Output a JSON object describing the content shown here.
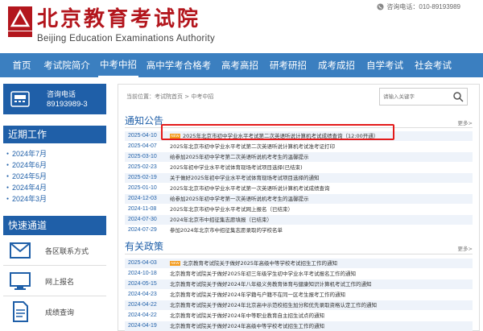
{
  "header": {
    "logo_cn": "北京教育考试院",
    "logo_en": "Beijing Education Examinations Authority",
    "hotline": "咨询电话：010-89193989"
  },
  "nav": {
    "items": [
      {
        "label": "首页"
      },
      {
        "label": "考试院简介"
      },
      {
        "label": "中考中招"
      },
      {
        "label": "高中学考合格考"
      },
      {
        "label": "高考高招"
      },
      {
        "label": "研考研招"
      },
      {
        "label": "成考成招"
      },
      {
        "label": "自学考试"
      },
      {
        "label": "社会考试"
      }
    ]
  },
  "sidebar": {
    "hotline_title": "咨询电话",
    "hotline_number": "89193989-3",
    "recent_title": "近期工作",
    "months": [
      "2024年7月",
      "2024年6月",
      "2024年5月",
      "2024年4月",
      "2024年3月"
    ],
    "quick_title": "快速通道",
    "quick_items": [
      {
        "label": "各区联系方式",
        "icon": "contact-icon"
      },
      {
        "label": "网上报名",
        "icon": "monitor-icon"
      },
      {
        "label": "成绩查询",
        "icon": "document-icon"
      }
    ]
  },
  "main": {
    "breadcrumb": "当前位置：考试院首页 > 中考中招",
    "search_placeholder": "请输入关键字",
    "notice": {
      "title": "通知公告",
      "more": "更多>",
      "rows": [
        {
          "date": "2025-04-10",
          "badge": "NEW",
          "title": "2025年北京市初中学业水平考试第二次英语听说计算机考试成绩查询（12:00开通）"
        },
        {
          "date": "2025-04-07",
          "badge": "",
          "title": "2025年北京市初中学业水平考试第二次英语听说计算机考试准考证打印"
        },
        {
          "date": "2025-03-10",
          "badge": "",
          "title": "给参加2025年初中学考第二次英语听说机考考生的温馨提示"
        },
        {
          "date": "2025-02-23",
          "badge": "",
          "title": "2025年初中学业水平考试体育现场考试项目选择(已结束)"
        },
        {
          "date": "2025-02-19",
          "badge": "",
          "title": "关于做好2025年初中学业水平考试体育现场考试项目选择的通知"
        },
        {
          "date": "2025-01-10",
          "badge": "",
          "title": "2025年北京市初中学业水平考试第一次英语听说计算机考试成绩查询"
        },
        {
          "date": "2024-12-03",
          "badge": "",
          "title": "给参加2025年初中学考第一次英语听说机考考生的温馨提示"
        },
        {
          "date": "2024-11-08",
          "badge": "",
          "title": "2025年北京市初中学业水平考试网上报名（已结束）"
        },
        {
          "date": "2024-07-30",
          "badge": "",
          "title": "2024年北京市中招征集志愿填报（已结束）"
        },
        {
          "date": "2024-07-29",
          "badge": "",
          "title": "参加2024年北京市中招征集志愿录取的学校名单"
        }
      ]
    },
    "policy": {
      "title": "有关政策",
      "more": "更多>",
      "rows": [
        {
          "date": "2025-04-03",
          "badge": "NEW",
          "title": "北京教育考试院关于做好2025年高级中等学校考试招生工作的通知"
        },
        {
          "date": "2024-10-18",
          "badge": "",
          "title": "北京教育考试院关于做好2025年初三年级学生初中学业水平考试报名工作的通知"
        },
        {
          "date": "2024-05-15",
          "badge": "",
          "title": "北京教育考试院关于做好2024年八年级义务教育体育与健康知识计算机考试工作的通知"
        },
        {
          "date": "2024-04-23",
          "badge": "",
          "title": "北京教育考试院关于做好2024年学籍与户籍不在同一区考生报考工作的通知"
        },
        {
          "date": "2024-04-22",
          "badge": "",
          "title": "北京教育考试院关于做好2024年北京高中示范校招生加分和优先录取资格认定工作的通知"
        },
        {
          "date": "2024-04-22",
          "badge": "",
          "title": "北京教育考试院关于做好2024年中等职业教育自主招生试点的通知"
        },
        {
          "date": "2024-04-19",
          "badge": "",
          "title": "北京教育考试院关于做好2024年高级中等学校考试招生工作的通知"
        }
      ]
    }
  },
  "colors": {
    "brand_red": "#b3161d",
    "nav_blue": "#3b7fc0",
    "dark_blue": "#1f5fa8",
    "badge_orange": "#f39a1c",
    "highlight_red": "#e31b1b"
  }
}
